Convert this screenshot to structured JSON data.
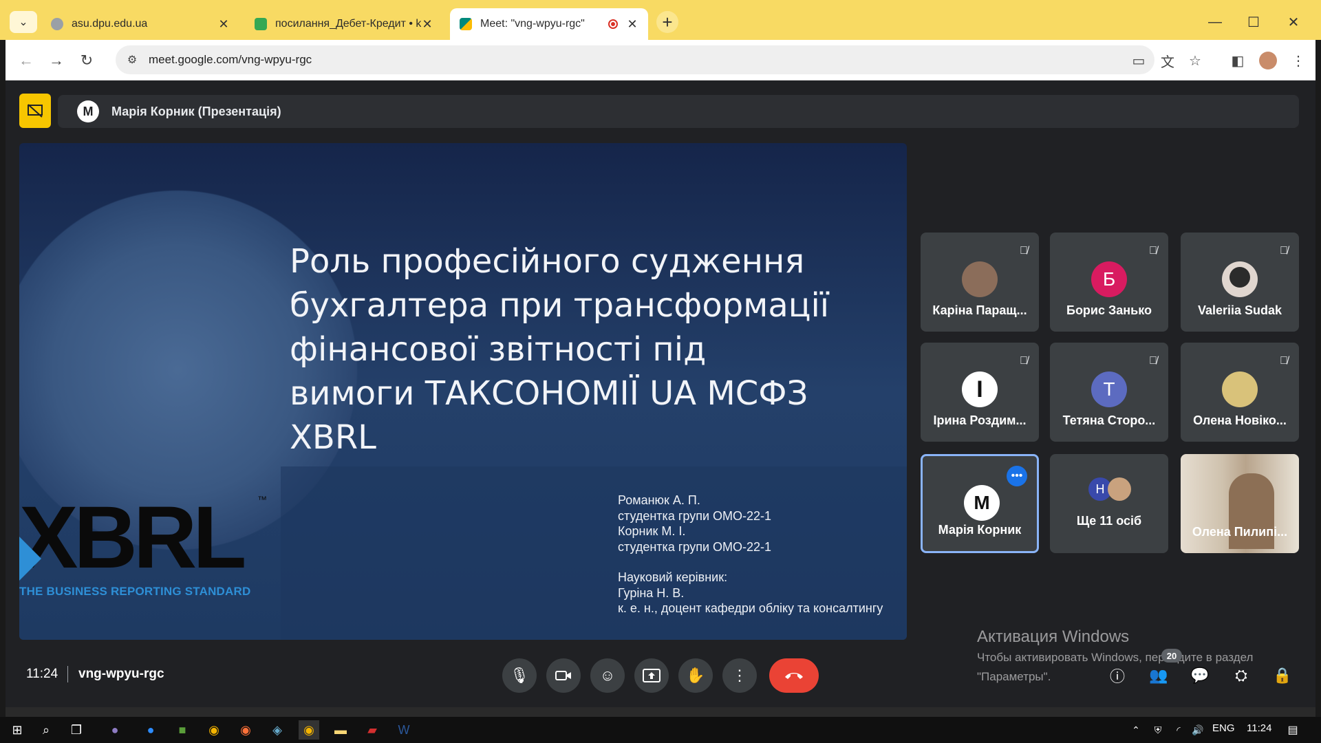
{
  "browser": {
    "tabs": [
      {
        "title": "asu.dpu.edu.ua",
        "favicon_color": "#9aa0a6"
      },
      {
        "title": "посилання_Дебет-Кредит • ko",
        "favicon_color": "#34a853"
      },
      {
        "title": "Meet: \"vng-wpyu-rgc\"",
        "favicon_color": "#00897b"
      }
    ],
    "url": "meet.google.com/vng-wpyu-rgc",
    "chrome_color": "#f8da63"
  },
  "presentation": {
    "presenter_initial": "М",
    "presenter_label": "Марія Корник (Презентація)"
  },
  "slide": {
    "title": "Роль професійного судження бухгалтера при трансформації фінансової звітності під вимоги ТАКСОНОМІЇ UA МСФЗ XBRL",
    "authors": [
      "Романюк А. П.",
      "студентка групи ОМО-22-1",
      "Корник М. І.",
      "студентка групи ОМО-22-1"
    ],
    "supervisor": [
      "Науковий керівник:",
      "Гуріна Н. В.",
      "к. е. н., доцент кафедри обліку та консалтингу"
    ],
    "logo_text": "XBRL",
    "logo_tm": "™",
    "logo_tagline": "THE BUSINESS REPORTING STANDARD"
  },
  "participants": [
    {
      "name": "Каріна Паращ...",
      "avatar": "photo",
      "muted": true
    },
    {
      "name": "Борис Занько",
      "initial": "Б",
      "color": "#d81b60",
      "muted": true
    },
    {
      "name": "Valeriia Sudak",
      "avatar": "photo",
      "muted": true
    },
    {
      "name": "Ірина Роздим...",
      "initial": "I",
      "color": "#ffffff",
      "muted": true
    },
    {
      "name": "Тетяна Сторо...",
      "initial": "Т",
      "color": "#5c6bc0",
      "muted": true
    },
    {
      "name": "Олена Новіко...",
      "avatar": "photo",
      "muted": true
    },
    {
      "name": "Марія Корник",
      "initial": "M",
      "color": "#ffffff",
      "active": true
    },
    {
      "name": "Ще 11 осіб",
      "initial": "Н"
    },
    {
      "name": "Олена Пилипі...",
      "avatar": "video"
    }
  ],
  "controls": {
    "time": "11:24",
    "meeting_code": "vng-wpyu-rgc",
    "people_count": "20"
  },
  "windows_activation": {
    "title": "Активация Windows",
    "line1": "Чтобы активировать Windows, перейдите в раздел",
    "line2": "\"Параметры\"."
  },
  "taskbar": {
    "lang": "ENG",
    "time": "11:24"
  }
}
